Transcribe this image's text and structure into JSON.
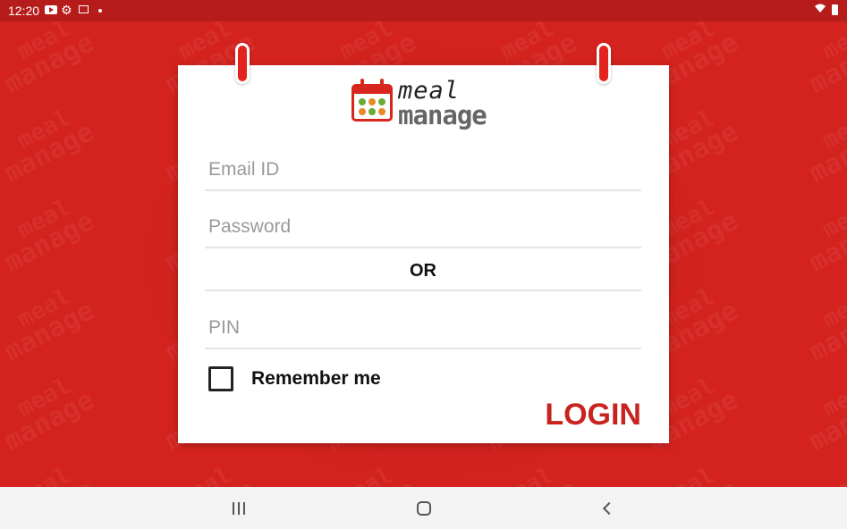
{
  "status_bar": {
    "time": "12:20",
    "icons": [
      "youtube-icon",
      "gear-icon",
      "window-icon",
      "dot-icon",
      "wifi-icon",
      "battery-icon"
    ]
  },
  "background": {
    "color": "#d4231f",
    "watermark_line1": "meal",
    "watermark_line2": "manage"
  },
  "logo": {
    "line1": "meal",
    "line2": "manage",
    "accent_color": "#d6261e"
  },
  "form": {
    "email_placeholder": "Email ID",
    "email_value": "",
    "password_placeholder": "Password",
    "password_value": "",
    "or_label": "OR",
    "pin_placeholder": "PIN",
    "pin_value": "",
    "remember_label": "Remember me",
    "remember_checked": false,
    "login_label": "LOGIN",
    "login_color": "#c8231f"
  },
  "nav_bar": {
    "buttons": [
      "recents-icon",
      "home-icon",
      "back-icon"
    ]
  }
}
